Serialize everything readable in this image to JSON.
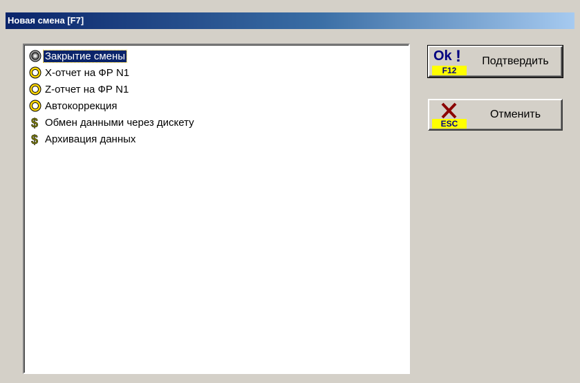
{
  "window": {
    "title": "Новая смена [F7]"
  },
  "list": {
    "items": [
      {
        "label": "Закрытие смены",
        "icon": "gear-icon",
        "selected": true
      },
      {
        "label": "X-отчет на ФР N1",
        "icon": "gear-icon",
        "selected": false
      },
      {
        "label": "Z-отчет на ФР N1",
        "icon": "gear-icon",
        "selected": false
      },
      {
        "label": "Автокоррекция",
        "icon": "gear-icon",
        "selected": false
      },
      {
        "label": "Обмен данными через дискету",
        "icon": "dollar-icon",
        "selected": false
      },
      {
        "label": "Архивация данных",
        "icon": "dollar-icon",
        "selected": false
      }
    ]
  },
  "buttons": {
    "confirm": {
      "label": "Подтвердить",
      "badge": "Ok",
      "exclamation": "!",
      "key": "F12"
    },
    "cancel": {
      "label": "Отменить",
      "key": "ESC"
    }
  },
  "colors": {
    "title_start": "#0a246a",
    "title_end": "#a6caf0",
    "selection": "#0a246a",
    "key_bg": "#ffff00"
  }
}
